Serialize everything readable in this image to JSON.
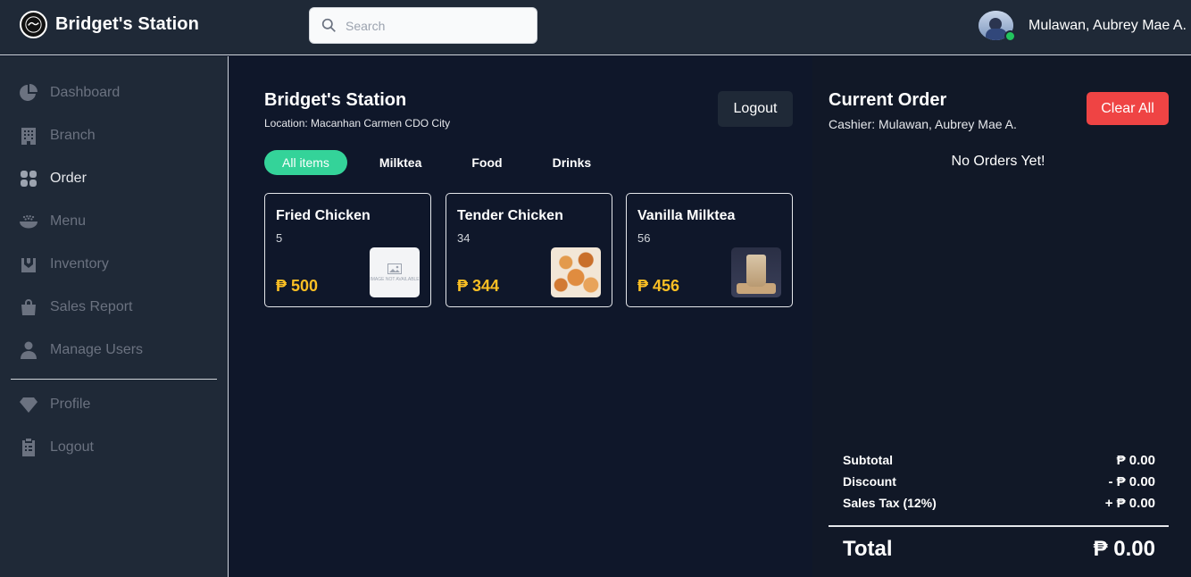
{
  "header": {
    "brand": "Bridget's Station",
    "search_placeholder": "Search",
    "user_name": "Mulawan, Aubrey Mae A."
  },
  "sidebar": {
    "items": [
      {
        "label": "Dashboard",
        "icon": "pie-chart-icon"
      },
      {
        "label": "Branch",
        "icon": "building-icon"
      },
      {
        "label": "Order",
        "icon": "grid-icon",
        "active": true
      },
      {
        "label": "Menu",
        "icon": "bowl-icon"
      },
      {
        "label": "Inventory",
        "icon": "inventory-icon"
      },
      {
        "label": "Sales Report",
        "icon": "shopping-bag-icon"
      },
      {
        "label": "Manage Users",
        "icon": "user-icon"
      }
    ],
    "bottom_items": [
      {
        "label": "Profile",
        "icon": "diamond-icon"
      },
      {
        "label": "Logout",
        "icon": "clipboard-icon"
      }
    ]
  },
  "main": {
    "title": "Bridget's Station",
    "location": "Location: Macanhan Carmen CDO City",
    "logout_label": "Logout",
    "tabs": [
      "All items",
      "Milktea",
      "Food",
      "Drinks"
    ],
    "active_tab": "All items",
    "products": [
      {
        "name": "Fried Chicken",
        "qty": "5",
        "price": "₱ 500",
        "image": "image-not-available",
        "image_text": "IMAGE NOT AVAILABLE"
      },
      {
        "name": "Tender Chicken",
        "qty": "34",
        "price": "₱ 344",
        "image": "fried-chicken-photo"
      },
      {
        "name": "Vanilla Milktea",
        "qty": "56",
        "price": "₱ 456",
        "image": "milktea-photo"
      }
    ]
  },
  "order": {
    "title": "Current Order",
    "cashier": "Cashier: Mulawan, Aubrey Mae A.",
    "clear_label": "Clear All",
    "empty_text": "No Orders Yet!",
    "subtotal_label": "Subtotal",
    "subtotal_value": "₱ 0.00",
    "discount_label": "Discount",
    "discount_value": "- ₱ 0.00",
    "tax_label": "Sales Tax (12%)",
    "tax_value": "+ ₱ 0.00",
    "total_label": "Total",
    "total_value": "₱ 0.00"
  },
  "colors": {
    "accent_green": "#34d399",
    "danger_red": "#ef4444",
    "price_gold": "#fbbf24",
    "online_dot": "#22c55e"
  }
}
